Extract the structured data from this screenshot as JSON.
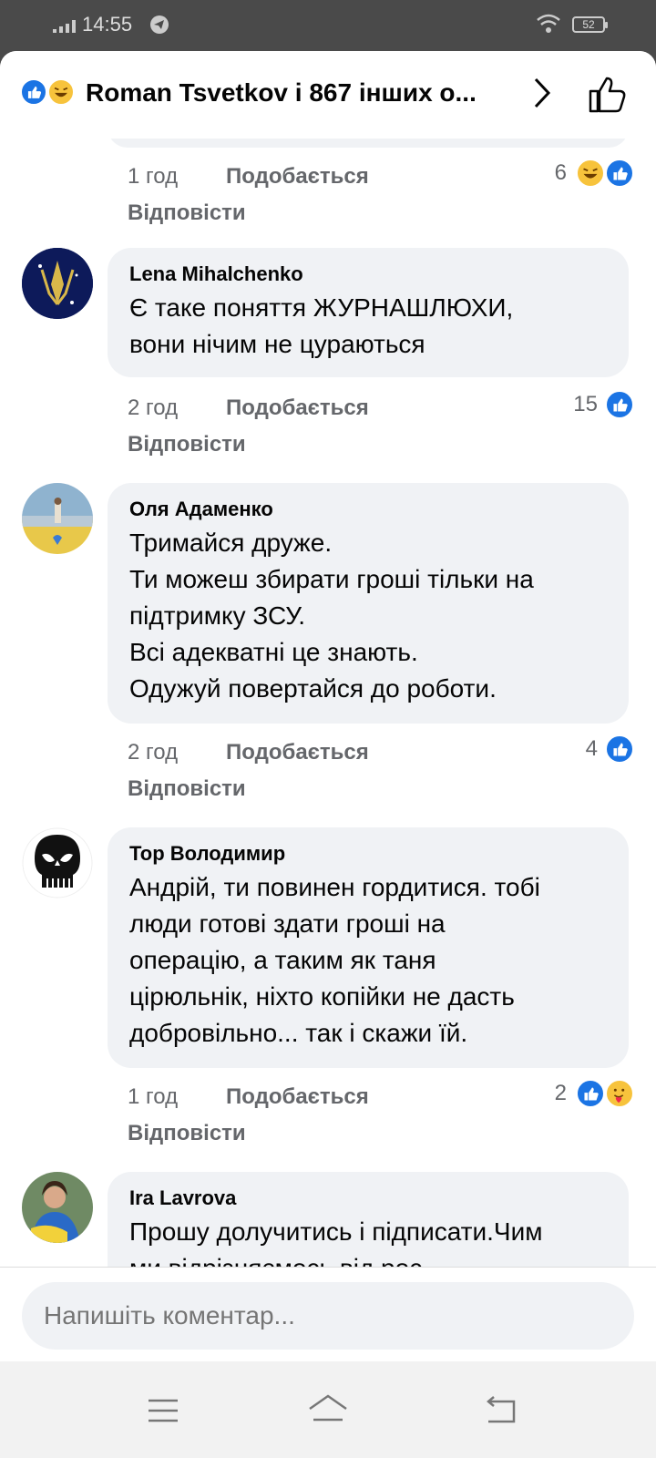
{
  "status_bar": {
    "time": "14:55",
    "battery": "52"
  },
  "header": {
    "title": "Roman Tsvetkov і 867 інших о...",
    "reactions": [
      "like",
      "haha"
    ]
  },
  "comments": [
    {
      "time": "1 год",
      "like_label": "Подобається",
      "reply_label": "Відповісти",
      "reaction_count": "6",
      "reactions": [
        "haha",
        "like"
      ]
    },
    {
      "author": "Lena Mihalchenko",
      "text": "Є таке поняття ЖУРНАШЛЮХИ,\nвони нічим не цураються",
      "time": "2 год",
      "like_label": "Подобається",
      "reply_label": "Відповісти",
      "reaction_count": "15",
      "reactions": [
        "like"
      ]
    },
    {
      "author": "Оля Адаменко",
      "text": "Тримайся друже.\nТи можеш збирати гроші тільки на\nпідтримку ЗСУ.\nВсі адекватні це знають.\nОдужуй повертайся до роботи.",
      "time": "2 год",
      "like_label": "Подобається",
      "reply_label": "Відповісти",
      "reaction_count": "4",
      "reactions": [
        "like"
      ]
    },
    {
      "author": "Top Володимир",
      "text": "Андрій, ти повинен гордитися. тобі\nлюди готові здати гроші на\nоперацію, а таким як таня\nцірюльнік, ніхто копійки не дасть\nдобровільно... так і скажи їй.",
      "time": "1 год",
      "like_label": "Подобається",
      "reply_label": "Відповісти",
      "reaction_count": "2",
      "reactions": [
        "like",
        "care"
      ]
    },
    {
      "author": "Ira Lavrova",
      "text": "Прошу долучитись і підписати.Чим\nми відрізняємось від рос"
    }
  ],
  "composer": {
    "placeholder": "Напишіть коментар..."
  },
  "colors": {
    "accent": "#1b74e4",
    "bubble": "#f0f2f5",
    "meta": "#65676b",
    "status_bg": "#4a4a4a"
  }
}
